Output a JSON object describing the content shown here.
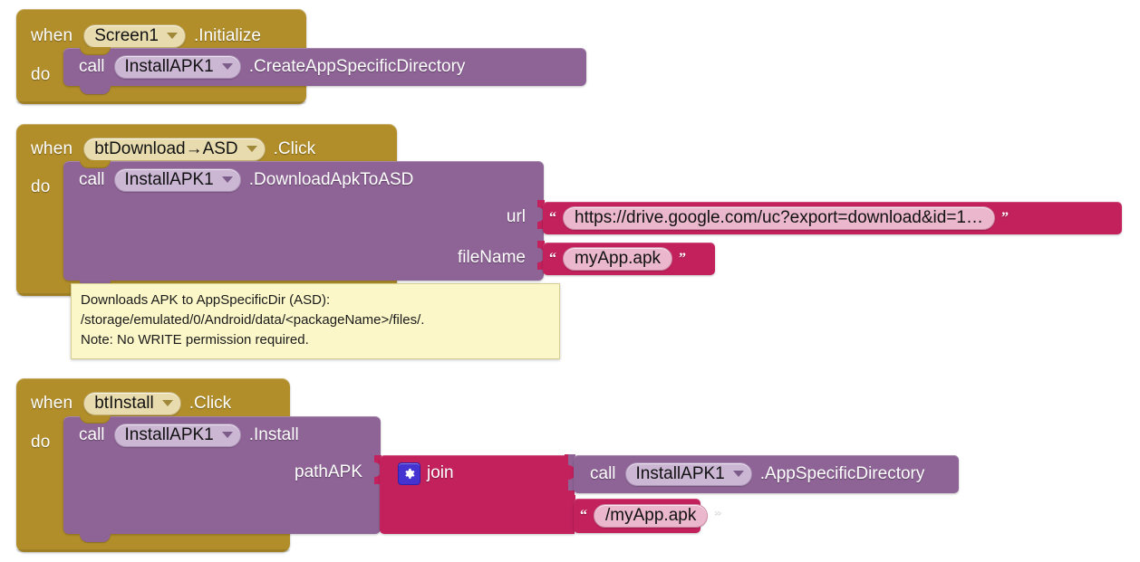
{
  "workspace": {
    "background": "#ffffff",
    "colors": {
      "event_block": "#B18E2A",
      "call_block": "#8E6496",
      "text_block": "#C2215C",
      "field_gold": "#E8DCAF",
      "field_purple": "#CBB6D4",
      "field_crimson": "#EBB7CC",
      "mutator_gear": "#4433D0",
      "comment_balloon": "#FBF7C8"
    }
  },
  "blocks": [
    {
      "id": "block-screen1-initialize",
      "type": "event",
      "when_label": "when",
      "component": "Screen1",
      "event_suffix": ".Initialize",
      "do_label": "do",
      "body": {
        "call_label": "call",
        "component": "InstallAPK1",
        "method": ".CreateAppSpecificDirectory"
      }
    },
    {
      "id": "block-btdownload-click",
      "type": "event",
      "when_label": "when",
      "component": "btDownload→ASD",
      "event_suffix": ".Click",
      "do_label": "do",
      "body": {
        "call_label": "call",
        "component": "InstallAPK1",
        "method": ".DownloadApkToASD",
        "args": [
          {
            "name": "url",
            "value": "https://drive.google.com/uc?export=download&id=1…",
            "open_quote": "“",
            "close_quote": "”"
          },
          {
            "name": "fileName",
            "value": "myApp.apk",
            "open_quote": "“",
            "close_quote": "”"
          }
        ]
      }
    },
    {
      "id": "block-btinstall-click",
      "type": "event",
      "when_label": "when",
      "component": "btInstall",
      "event_suffix": ".Click",
      "do_label": "do",
      "body": {
        "call_label": "call",
        "component": "InstallAPK1",
        "method": ".Install",
        "args": [
          {
            "name": "pathAPK",
            "value_block": {
              "type": "join",
              "label": "join",
              "mutator_icon": "gear-icon",
              "items": [
                {
                  "type": "call",
                  "call_label": "call",
                  "component": "InstallAPK1",
                  "method": ".AppSpecificDirectory"
                },
                {
                  "type": "text",
                  "value": "/myApp.apk",
                  "open_quote": "“",
                  "close_quote": "”"
                }
              ]
            }
          }
        ]
      }
    }
  ],
  "comment": {
    "line1": "Downloads APK to AppSpecificDir (ASD):",
    "line2": "/storage/emulated/0/Android/data/<packageName>/files/.",
    "line3": "Note: No WRITE permission required."
  }
}
